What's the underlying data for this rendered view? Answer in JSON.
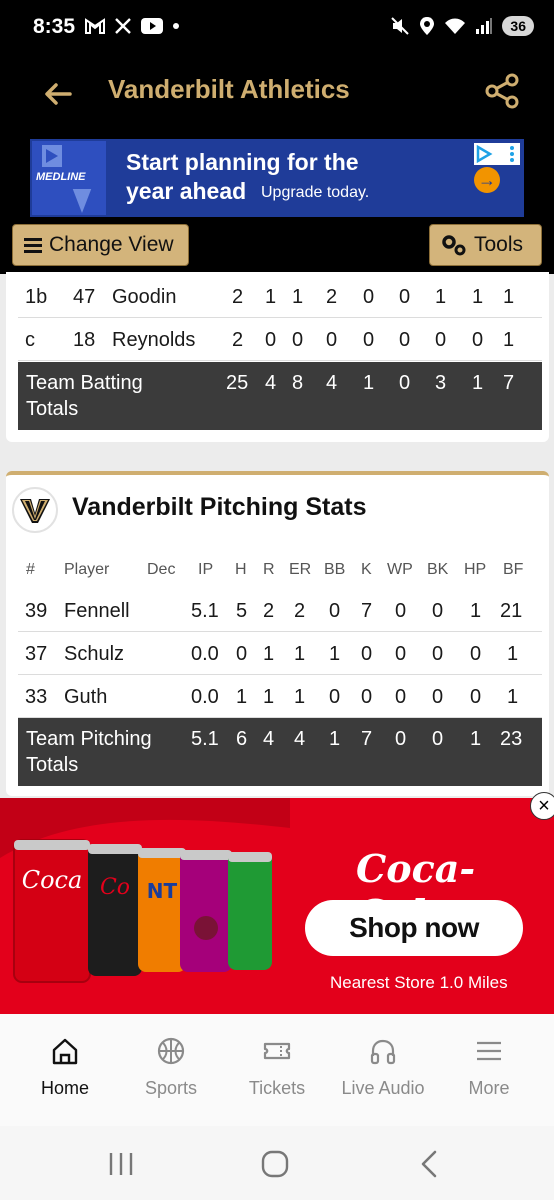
{
  "status_bar": {
    "time": "8:35",
    "battery": "36"
  },
  "header": {
    "title": "Vanderbilt Athletics"
  },
  "ad_top": {
    "brand": "MEDLINE",
    "line1": "Start planning for the",
    "line2": "year ahead",
    "line2b": "Upgrade today."
  },
  "toolbar": {
    "change_view": "Change View",
    "tools": "Tools"
  },
  "batting": {
    "rows": [
      {
        "pos": "1b",
        "num": "47",
        "name": "Goodin",
        "v": [
          "2",
          "1",
          "1",
          "2",
          "0",
          "0",
          "1",
          "1",
          "1"
        ]
      },
      {
        "pos": "c",
        "num": "18",
        "name": "Reynolds",
        "v": [
          "2",
          "0",
          "0",
          "0",
          "0",
          "0",
          "0",
          "0",
          "1"
        ]
      }
    ],
    "totals": {
      "label": "Team Batting Totals",
      "v": [
        "25",
        "4",
        "8",
        "4",
        "1",
        "0",
        "3",
        "1",
        "7"
      ]
    }
  },
  "pitching": {
    "title": "Vanderbilt Pitching Stats",
    "headers": [
      "#",
      "Player",
      "Dec",
      "IP",
      "H",
      "R",
      "ER",
      "BB",
      "K",
      "WP",
      "BK",
      "HP",
      "BF"
    ],
    "rows": [
      {
        "num": "39",
        "name": "Fennell",
        "dec": "",
        "v": [
          "5.1",
          "5",
          "2",
          "2",
          "0",
          "7",
          "0",
          "0",
          "1",
          "21"
        ]
      },
      {
        "num": "37",
        "name": "Schulz",
        "dec": "",
        "v": [
          "0.0",
          "0",
          "1",
          "1",
          "1",
          "0",
          "0",
          "0",
          "0",
          "1"
        ]
      },
      {
        "num": "33",
        "name": "Guth",
        "dec": "",
        "v": [
          "0.0",
          "1",
          "1",
          "1",
          "0",
          "0",
          "0",
          "0",
          "0",
          "1"
        ]
      }
    ],
    "totals": {
      "label": "Team Pitching Totals",
      "v": [
        "5.1",
        "6",
        "4",
        "4",
        "1",
        "7",
        "0",
        "0",
        "1",
        "23"
      ]
    }
  },
  "ad_coke": {
    "logo": "Coca-Cola",
    "shop": "Shop now",
    "nearest": "Nearest Store 1.0 Miles"
  },
  "bottom_nav": {
    "home": "Home",
    "sports": "Sports",
    "tickets": "Tickets",
    "live_audio": "Live Audio",
    "more": "More"
  },
  "colors": {
    "gold": "#cfae70",
    "black": "#000000",
    "total_bg": "#3b3b3b",
    "coke_red": "#e3001b"
  }
}
